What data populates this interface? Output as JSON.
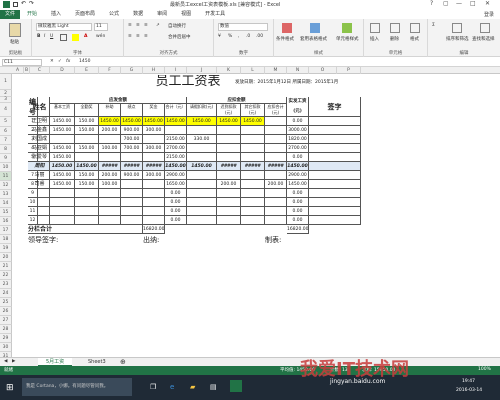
{
  "window": {
    "title": "最新员工excel工资表模板.xls [兼容模式] - Excel",
    "controls": [
      "?",
      "▢",
      "—",
      "□",
      "✕"
    ]
  },
  "ribbon": {
    "file_tab": "文件",
    "tabs": [
      "开始",
      "插入",
      "页面布局",
      "公式",
      "数据",
      "审阅",
      "视图",
      "开发工具"
    ],
    "login": "登录",
    "clipboard": {
      "paste": "粘贴",
      "group": "剪贴板"
    },
    "font": {
      "name": "微软雅黑 Light",
      "size": "11",
      "group": "字体",
      "wen": "wén"
    },
    "alignment": {
      "wrap": "自动换行",
      "merge": "合并后居中",
      "group": "对齐方式"
    },
    "number": {
      "format": "数值",
      "group": "数字"
    },
    "styles": {
      "cond": "条件格式",
      "table": "套用表格格式",
      "cell": "单元格样式",
      "group": "样式"
    },
    "cells": {
      "insert": "插入",
      "delete": "删除",
      "format": "格式",
      "group": "单元格"
    },
    "editing": {
      "sort": "排序和筛选",
      "find": "查找和选择",
      "group": "编辑"
    }
  },
  "formula_bar": {
    "name_box": "C11",
    "fx": "fx",
    "value": "1450"
  },
  "columns": [
    "A",
    "B",
    "C",
    "D",
    "E",
    "F",
    "G",
    "H",
    "I",
    "J",
    "K",
    "L",
    "M",
    "N",
    "O",
    "P"
  ],
  "sheet": {
    "title": "员工工资表",
    "issue_date": "发放日期：2015年1月12日 所属日期：2015年1月",
    "hdr_no": "编号",
    "hdr_name": "姓名",
    "hdr_payable": "应发金额",
    "hdr_deduct": "应扣金额",
    "hdr_actual": "实发工资(元)",
    "hdr_sign": "签字",
    "sub_headers": [
      "基本工资",
      "全勤奖",
      "补助",
      "绩点",
      "奖金",
      "合计（元）",
      "请假扣款(元)",
      "迟到扣款(元)",
      "其它扣款(元)",
      "应扣合计(元)"
    ],
    "rows": [
      {
        "r": "1",
        "no": "1",
        "name": "王卫明",
        "cells": [
          "1450.00",
          "150.00",
          "1450.00",
          "1450.00",
          "1450.00",
          "1450.00",
          "1450.00",
          "1450.00",
          "1450.00",
          "",
          "0.00"
        ]
      },
      {
        "r": "2",
        "no": "2",
        "name": "马金鑫",
        "cells": [
          "1450.00",
          "150.00",
          "200.00",
          "900.00",
          "300.00",
          "",
          "",
          "",
          "",
          "",
          "3000.00"
        ]
      },
      {
        "r": "3",
        "no": "3",
        "name": "刘国成",
        "cells": [
          "",
          "",
          "",
          "700.00",
          "",
          "2150.00",
          "330.00",
          "",
          "",
          "",
          "1820.00"
        ]
      },
      {
        "r": "4",
        "no": "4",
        "name": "马亚娟",
        "cells": [
          "1450.00",
          "150.00",
          "100.00",
          "700.00",
          "300.00",
          "2700.00",
          "",
          "",
          "",
          "",
          "2700.00"
        ]
      },
      {
        "r": "5",
        "no": "5",
        "name": "张爱琴",
        "cells": [
          "1450.00",
          "",
          "",
          "",
          "",
          "2150.00",
          "",
          "",
          "",
          "",
          "0.00"
        ]
      },
      {
        "r": "6",
        "no": "6",
        "name": "周阳",
        "cells": [
          "1450.00",
          "1450.00",
          "#####",
          "#####",
          "#####",
          "1450.00",
          "1450.00",
          "#####",
          "#####",
          "#####",
          "1450.00"
        ]
      },
      {
        "r": "7",
        "no": "7",
        "name": "马丽",
        "cells": [
          "1450.00",
          "150.00",
          "200.00",
          "900.00",
          "300.00",
          "2900.00",
          "",
          "",
          "",
          "",
          "2900.00"
        ]
      },
      {
        "r": "8",
        "no": "8",
        "name": "司睿",
        "cells": [
          "1450.00",
          "150.00",
          "100.00",
          "",
          "",
          "1650.00",
          "",
          "200.00",
          "",
          "200.00",
          "1450.00"
        ]
      },
      {
        "r": "9",
        "no": "9",
        "name": "",
        "cells": [
          "",
          "",
          "",
          "",
          "",
          "0.00",
          "",
          "",
          "",
          "",
          "0.00"
        ]
      },
      {
        "r": "10",
        "no": "10",
        "name": "",
        "cells": [
          "",
          "",
          "",
          "",
          "",
          "0.00",
          "",
          "",
          "",
          "",
          "0.00"
        ]
      },
      {
        "r": "11",
        "no": "11",
        "name": "",
        "cells": [
          "",
          "",
          "",
          "",
          "",
          "0.00",
          "",
          "",
          "",
          "",
          "0.00"
        ]
      },
      {
        "r": "12",
        "no": "12",
        "name": "",
        "cells": [
          "",
          "",
          "",
          "",
          "",
          "0.00",
          "",
          "",
          "",
          "",
          "0.00"
        ]
      }
    ],
    "subtotal_label": "分栏合计",
    "subtotal_value": "16820.00",
    "subtotal_actual": "16820.00",
    "leader": "领导签字:",
    "cashier": "出纳:",
    "preparer": "制表:"
  },
  "row_numbers": [
    "1",
    "2",
    "3",
    "4",
    "5",
    "6",
    "7",
    "8",
    "9",
    "10",
    "11",
    "12",
    "13",
    "14",
    "15",
    "16",
    "17",
    "18",
    "19",
    "20",
    "21",
    "22",
    "23",
    "24",
    "25",
    "26",
    "27",
    "28",
    "29",
    "30",
    "31"
  ],
  "sheet_tabs": [
    "5月工资",
    "Sheet3"
  ],
  "status": {
    "left": "就绪",
    "average": "平均值: 1450.00",
    "count": "计数: 13",
    "sum": "求和: 15950.00",
    "zoom": "100%"
  },
  "taskbar": {
    "search": "我是 Cortana，小娜。有问题尽管问我。",
    "time": "19:47",
    "date": "2016-03-14"
  },
  "watermark": "我爱IT技术网",
  "watermark_url": "jingyan.baidu.com",
  "colors": {
    "excel_green": "#217346",
    "highlight_yellow": "#ffff00",
    "selection": "#dfe9f5"
  }
}
